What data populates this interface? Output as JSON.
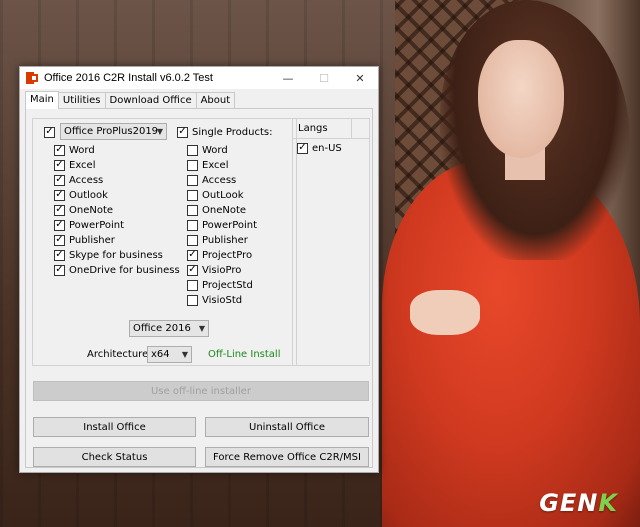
{
  "window": {
    "title": "Office 2016 C2R Install v6.0.2 Test",
    "icon": "office-icon",
    "controls": {
      "minimize": "—",
      "maximize": "☐",
      "close": "✕"
    }
  },
  "tabs": [
    "Main",
    "Utilities",
    "Download Office",
    "About"
  ],
  "suite": {
    "checked": true,
    "selected": "Office ProPlus2019:",
    "apps": [
      {
        "label": "Word",
        "checked": true
      },
      {
        "label": "Excel",
        "checked": true
      },
      {
        "label": "Access",
        "checked": true
      },
      {
        "label": "Outlook",
        "checked": true
      },
      {
        "label": "OneNote",
        "checked": true
      },
      {
        "label": "PowerPoint",
        "checked": true
      },
      {
        "label": "Publisher",
        "checked": true
      },
      {
        "label": "Skype for business",
        "checked": true
      },
      {
        "label": "OneDrive for business",
        "checked": true
      }
    ]
  },
  "single": {
    "checked": true,
    "label": "Single Products:",
    "products": [
      {
        "label": "Word",
        "checked": false
      },
      {
        "label": "Excel",
        "checked": false
      },
      {
        "label": "Access",
        "checked": false
      },
      {
        "label": "OutLook",
        "checked": false
      },
      {
        "label": "OneNote",
        "checked": false
      },
      {
        "label": "PowerPoint",
        "checked": false
      },
      {
        "label": "Publisher",
        "checked": false
      },
      {
        "label": "ProjectPro",
        "checked": true
      },
      {
        "label": "VisioPro",
        "checked": true
      },
      {
        "label": "ProjectStd",
        "checked": false
      },
      {
        "label": "VisioStd",
        "checked": false
      }
    ]
  },
  "langs": {
    "title": "Langs",
    "items": [
      {
        "label": "en-US",
        "checked": true
      }
    ]
  },
  "version_select": "Office 2016",
  "architecture": {
    "label": "Architecture:",
    "value": "x64"
  },
  "offline_status": "Off-Line Install",
  "buttons": {
    "use_offline": "Use off-line installer",
    "install": "Install Office",
    "uninstall": "Uninstall Office",
    "check_status": "Check Status",
    "force_remove": "Force Remove Office C2R/MSI"
  },
  "watermark": {
    "prefix": "GEN",
    "accent": "K"
  },
  "colors": {
    "status_green": "#1b8a1b",
    "office_orange": "#d83b01"
  }
}
